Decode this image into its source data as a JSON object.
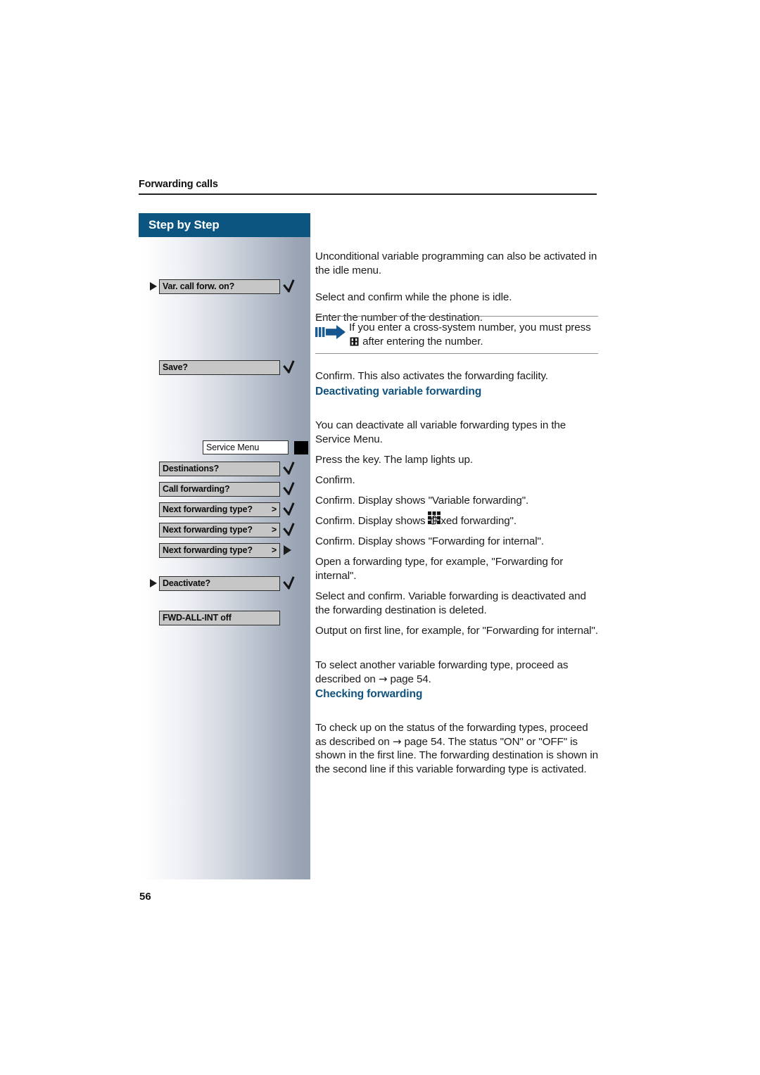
{
  "page": {
    "running_head": "Forwarding calls",
    "folio": "56",
    "accent_blue": "#10537e",
    "header_bar_blue": "#0d5581"
  },
  "sidebar": {
    "title": "Step by Step",
    "rows": [
      {
        "marker": "triangle",
        "label": "Var. call forw. on?",
        "suffix": "",
        "mark": "check"
      },
      {
        "marker": "none",
        "label": "",
        "suffix": "",
        "mark": "keypad"
      },
      {
        "marker": "none",
        "label": "Save?",
        "suffix": "",
        "mark": "check"
      },
      {
        "marker": "none",
        "label": "Service Menu",
        "suffix": "",
        "mark": "blackkey"
      },
      {
        "marker": "none",
        "label": "Destinations?",
        "suffix": "",
        "mark": "check"
      },
      {
        "marker": "none",
        "label": "Call forwarding?",
        "suffix": "",
        "mark": "check"
      },
      {
        "marker": "none",
        "label": "Next forwarding type?",
        "suffix": ">",
        "mark": "check"
      },
      {
        "marker": "none",
        "label": "Next forwarding type?",
        "suffix": ">",
        "mark": "check"
      },
      {
        "marker": "none",
        "label": "Next forwarding type?",
        "suffix": ">",
        "mark": "triangle"
      },
      {
        "marker": "triangle",
        "label": "Deactivate?",
        "suffix": "",
        "mark": "check"
      },
      {
        "marker": "none",
        "label": "FWD-ALL-INT off",
        "suffix": "",
        "mark": "none"
      }
    ],
    "labels": {
      "var_call_forw_on": "Var. call forw. on?",
      "save": "Save?",
      "service_menu": "Service Menu",
      "destinations": "Destinations?",
      "call_forwarding": "Call forwarding?",
      "next_forwarding_type_1": "Next forwarding type?",
      "next_forwarding_type_2": "Next forwarding type?",
      "next_forwarding_type_3": "Next forwarding type?",
      "deactivate": "Deactivate?",
      "fwd_all_int_off": "FWD-ALL-INT off",
      "chevron": ">"
    }
  },
  "body": {
    "p_intro": "Unconditional variable programming can also be activated in the idle menu.",
    "p_select_confirm_idle": "Select and confirm while the phone is idle.",
    "p_enter_number": "Enter the number of the destination.",
    "note_text_before": "If you enter a cross-system number, you must press",
    "note_text_after": "after entering the number.",
    "p_confirm_activates": "Confirm. This also activates the forwarding facility.",
    "h_deactivating": "Deactivating variable forwarding",
    "p_deactivate_all": "You can deactivate all variable forwarding types in the Service Menu.",
    "p_press_key_lamp": "Press the key. The lamp lights up.",
    "p_confirm": "Confirm.",
    "p_confirm_variable": "Confirm. Display shows \"Variable forwarding\".",
    "p_confirm_fixed": "Confirm. Display shows \"Fixed forwarding\".",
    "p_confirm_internal": "Confirm. Display shows \"Forwarding for internal\".",
    "p_open_type": "Open a forwarding type, for example, \"Forwarding for internal\".",
    "p_select_confirm_deact": "Select and confirm. Variable forwarding is deactivated and the forwarding destination is deleted.",
    "p_output_first_line": "Output on first line, for example, for \"Forwarding for internal\".",
    "p_select_another_a": "To select another variable forwarding type, proceed as described on",
    "p_select_another_b": "page 54.",
    "h_checking": "Checking forwarding",
    "p_checking_a": "To check up on the status of the forwarding types, proceed as described on",
    "p_checking_b": "page 54. The status \"ON\" or \"OFF\" is shown in the first line. The forwarding destination is shown in the second line if this variable forwarding type is activated.",
    "arrow_char": "→"
  }
}
